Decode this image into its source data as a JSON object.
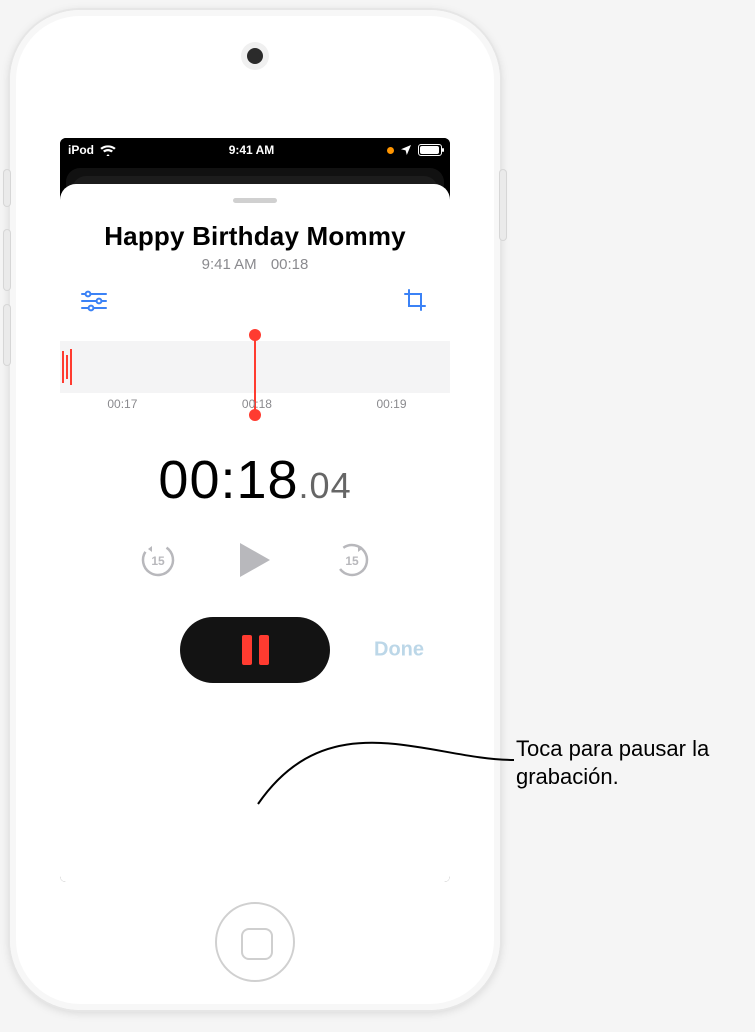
{
  "status": {
    "carrier": "iPod",
    "time": "9:41 AM"
  },
  "recording": {
    "title": "Happy Birthday Mommy",
    "subtitle_time": "9:41 AM",
    "subtitle_duration": "00:18",
    "elapsed_main": "00:18",
    "elapsed_frac": ".04",
    "ticks": {
      "prev": "00:17",
      "current": "00:18",
      "next": "00:19"
    },
    "skip_seconds": "15",
    "done_label": "Done"
  },
  "callout": {
    "text": "Toca para pausar la grabación."
  }
}
